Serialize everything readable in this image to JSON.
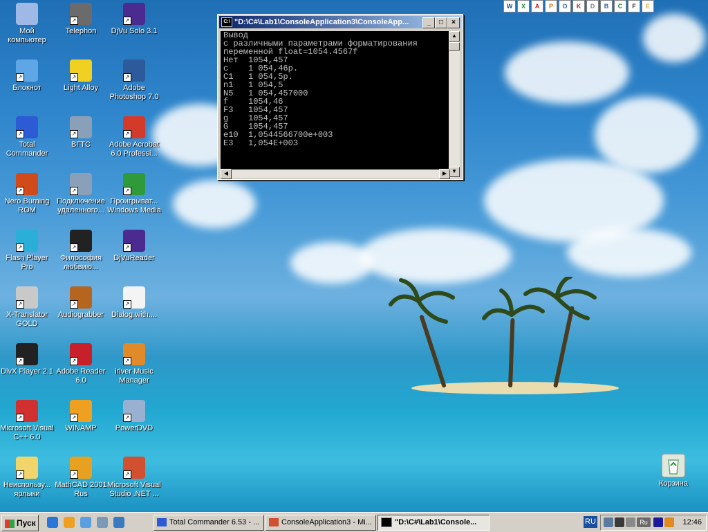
{
  "desktop_icons": [
    {
      "label": "Мой компьютер",
      "icon": "my-computer-icon",
      "color": "#9fb9e6"
    },
    {
      "label": "Telephon",
      "icon": "phone-icon",
      "color": "#6b6b6b"
    },
    {
      "label": "DjVu Solo 3.1",
      "icon": "djvu-icon",
      "color": "#4b2b8f"
    },
    {
      "label": "Блокнот",
      "icon": "notepad-icon",
      "color": "#5ea6e6"
    },
    {
      "label": "Light Alloy",
      "icon": "light-alloy-icon",
      "color": "#f0d020"
    },
    {
      "label": "Adobe Photoshop 7.0",
      "icon": "photoshop-icon",
      "color": "#2c5a9a"
    },
    {
      "label": "Total Commander",
      "icon": "total-commander-icon",
      "color": "#2d5bd6"
    },
    {
      "label": "ВГТС",
      "icon": "network-icon",
      "color": "#8aa0b8"
    },
    {
      "label": "Adobe Acrobat 6.0 Professi...",
      "icon": "acrobat-icon",
      "color": "#d43a2a"
    },
    {
      "label": "Nero Burning ROM",
      "icon": "nero-icon",
      "color": "#d04a1a"
    },
    {
      "label": "Подключение удаленного...",
      "icon": "remote-connection-icon",
      "color": "#8aa0b8"
    },
    {
      "label": "Проигрыват... Windows Media",
      "icon": "windows-media-icon",
      "color": "#2f9a3a"
    },
    {
      "label": "Flash Player Pro",
      "icon": "flash-player-icon",
      "color": "#2ab0d8"
    },
    {
      "label": "Философия любвию...",
      "icon": "yin-yang-icon",
      "color": "#222222"
    },
    {
      "label": "DjVuReader",
      "icon": "djvu-reader-icon",
      "color": "#4b2b8f"
    },
    {
      "label": "X-Translator GOLD",
      "icon": "translator-icon",
      "color": "#c9c9c9"
    },
    {
      "label": "Audiograbber",
      "icon": "audiograbber-icon",
      "color": "#b5651d"
    },
    {
      "label": "Dialog.with....",
      "icon": "document-icon",
      "color": "#f4f4f4"
    },
    {
      "label": "DivX Player 2.1",
      "icon": "divx-icon",
      "color": "#222222"
    },
    {
      "label": "Adobe Reader 6.0",
      "icon": "adobe-reader-icon",
      "color": "#c8202a"
    },
    {
      "label": "iriver Music Manager",
      "icon": "iriver-icon",
      "color": "#e08a2a"
    },
    {
      "label": "Microsoft Visual C++ 6.0",
      "icon": "visual-cpp-icon",
      "color": "#d03030"
    },
    {
      "label": "WINAMP",
      "icon": "winamp-icon",
      "color": "#f0a020"
    },
    {
      "label": "PowerDVD",
      "icon": "powerdvd-icon",
      "color": "#9ab0d0"
    },
    {
      "label": "Неиспользу... ярлыки",
      "icon": "folder-icon",
      "color": "#f2d56a"
    },
    {
      "label": "MathCAD 2001 Rus",
      "icon": "mathcad-icon",
      "color": "#e8a020"
    },
    {
      "label": "Microsoft Visual Studio .NET ...",
      "icon": "visual-studio-icon",
      "color": "#d05030"
    }
  ],
  "recycle_bin": {
    "label": "Корзина",
    "icon": "recycle-bin-icon"
  },
  "top_quicklaunch": [
    "W",
    "X",
    "A",
    "P",
    "O",
    "K",
    "D",
    "B",
    "C",
    "F",
    "E"
  ],
  "console": {
    "title": "\"D:\\C#\\Lab1\\ConsoleApplication3\\ConsoleApp...",
    "lines": [
      "Вывод",
      "с различными параметрами форматирования",
      "переменной float=1054.4567f",
      "Нет  1054,457",
      "c    1 054,46р.",
      "C1   1 054,5р.",
      "n1   1 054,5",
      "N5   1 054,457000",
      "f    1054,46",
      "F3   1054,457",
      "g    1054,457",
      "G    1054,457",
      "e10  1,0544566700e+003",
      "E3   1,054E+003"
    ],
    "minimize": "_",
    "maximize": "□",
    "close": "×"
  },
  "taskbar": {
    "start_label": "Пуск",
    "tasks": [
      {
        "label": "Total Commander 6.53 - ...",
        "active": false
      },
      {
        "label": "ConsoleApplication3 - Mi...",
        "active": false
      },
      {
        "label": "\"D:\\C#\\Lab1\\Console...",
        "active": true
      }
    ],
    "language": "RU",
    "tray_lang": "Ru",
    "clock": "12:46"
  }
}
